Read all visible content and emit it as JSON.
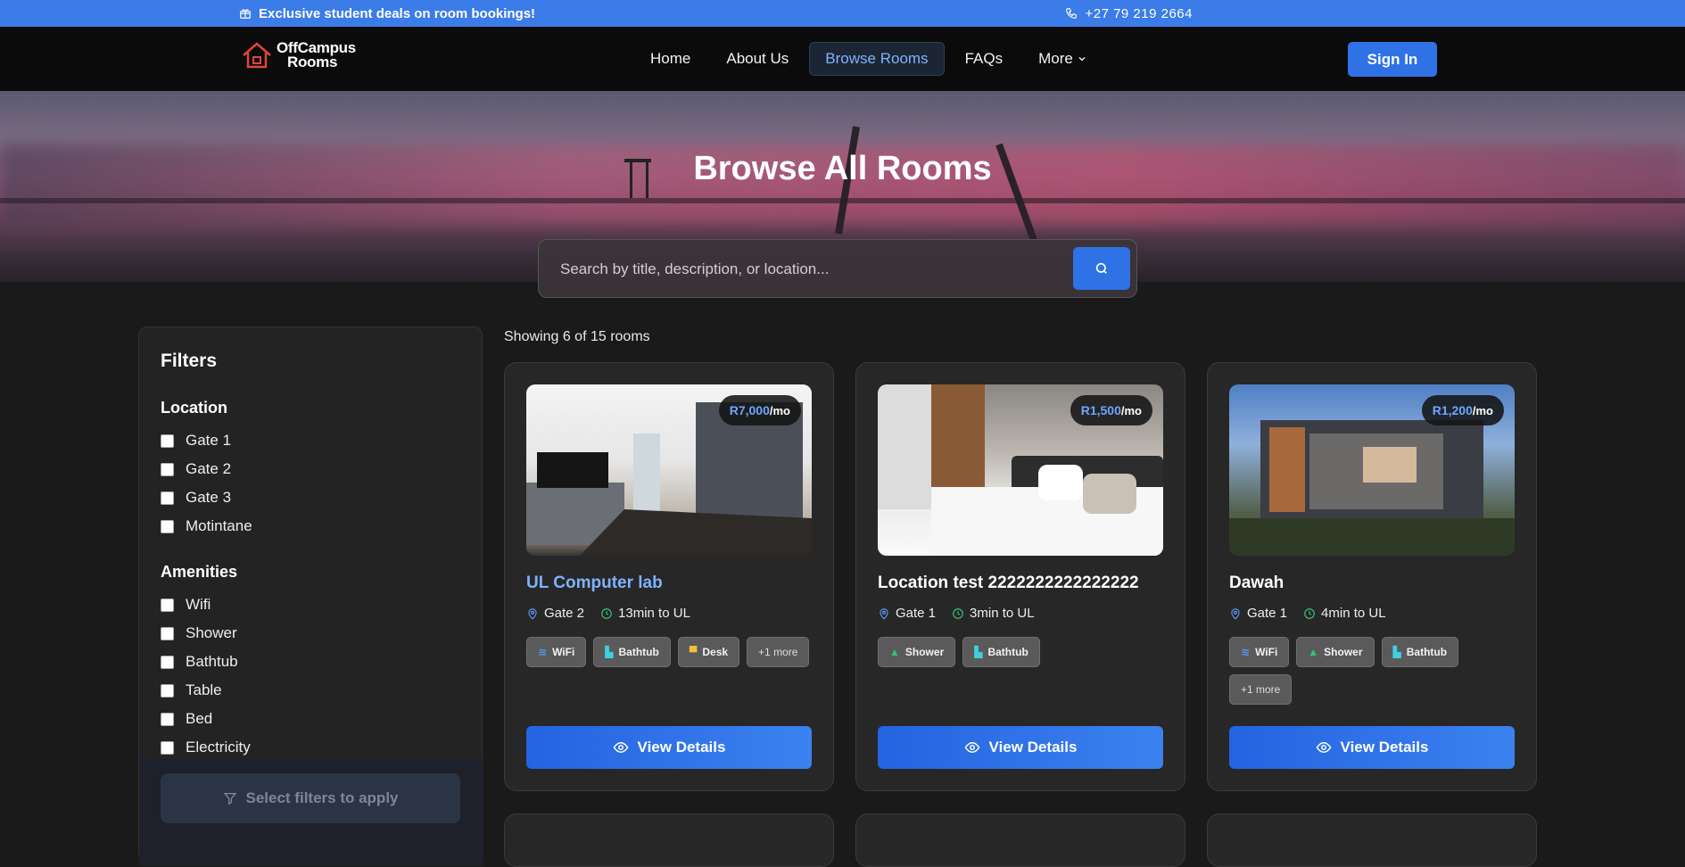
{
  "topbar": {
    "promo": "Exclusive student deals on room bookings!",
    "phone": "+27  79  219  2664"
  },
  "nav": {
    "logo_line1": "OffCampus",
    "logo_line2": "Rooms",
    "items": [
      {
        "label": "Home"
      },
      {
        "label": "About Us"
      },
      {
        "label": "Browse Rooms"
      },
      {
        "label": "FAQs"
      },
      {
        "label": "More"
      }
    ],
    "signin": "Sign In"
  },
  "hero": {
    "title": "Browse All Rooms",
    "search_placeholder": "Search by title, description, or location..."
  },
  "filters": {
    "title": "Filters",
    "location_title": "Location",
    "locations": [
      "Gate 1",
      "Gate 2",
      "Gate 3",
      "Motintane"
    ],
    "amenities_title": "Amenities",
    "amenities": [
      "Wifi",
      "Shower",
      "Bathtub",
      "Table",
      "Bed",
      "Electricity"
    ],
    "apply_label": "Select filters to apply"
  },
  "results": {
    "showing": "Showing 6 of 15 rooms"
  },
  "rooms": [
    {
      "price": "R7,000",
      "per": "/mo",
      "title": "UL Computer lab",
      "gate": "Gate 2",
      "time": "13min to UL",
      "tags": [
        "WiFi",
        "Bathtub",
        "Desk"
      ],
      "more": "+1 more",
      "view": "View Details"
    },
    {
      "price": "R1,500",
      "per": "/mo",
      "title": "Location test 2222222222222222",
      "gate": "Gate 1",
      "time": "3min to UL",
      "tags": [
        "Shower",
        "Bathtub"
      ],
      "view": "View Details"
    },
    {
      "price": "R1,200",
      "per": "/mo",
      "title": "Dawah",
      "gate": "Gate 1",
      "time": "4min to UL",
      "tags": [
        "WiFi",
        "Shower",
        "Bathtub"
      ],
      "more": "+1 more",
      "view": "View Details"
    }
  ],
  "colors": {
    "accent": "#2f72e6",
    "topbar": "#3b7ce8",
    "background": "#1a1a1a"
  }
}
